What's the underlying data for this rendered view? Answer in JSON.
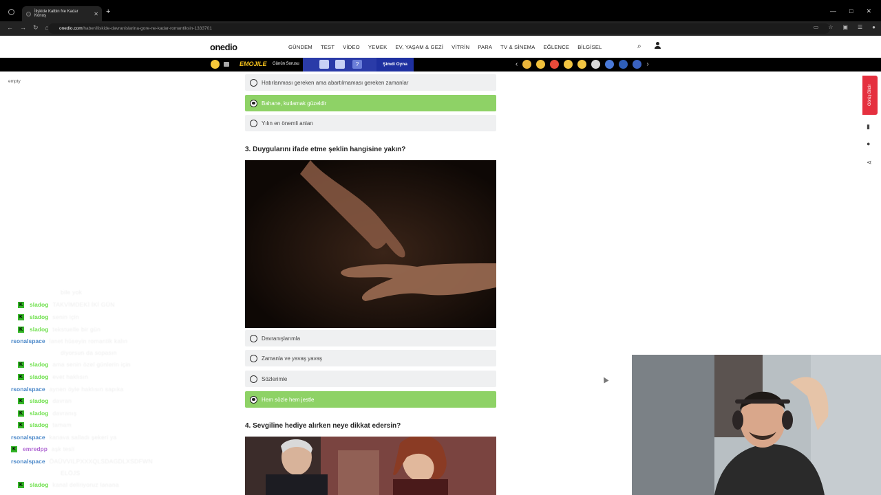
{
  "browser": {
    "tab_title": "İlişkide Kalbin Ne Kadar Konuş",
    "tab_close": "✕",
    "new_tab": "+",
    "url_host": "onedio.com",
    "url_path": "/haber/iliskide-davranislarina-gore-ne-kadar-romantiksin-1333701"
  },
  "site": {
    "logo": "onedio",
    "menu": [
      "GÜNDEM",
      "TEST",
      "VİDEO",
      "YEMEK",
      "EV, YAŞAM & GEZİ",
      "VİTRİN",
      "PARA",
      "TV & SİNEMA",
      "EĞLENCE",
      "BİLGİSEL"
    ]
  },
  "emoji_bar": {
    "brand": "EMOJILE",
    "daily": "Günün Sorusu",
    "question_mark": "?",
    "play": "Şimdi Oyna",
    "emoji_colors": [
      "#e9b43a",
      "#f0c03b",
      "#e84a3a",
      "#f2c542",
      "#f2c542",
      "#d9d9d9",
      "#4a7ad9",
      "#2f5fb8",
      "#3a62c0"
    ]
  },
  "sidebar": {
    "empty_label": "empty"
  },
  "quiz": {
    "q2_options": [
      {
        "label": "Hatırlanması gereken ama abartılmaması gereken zamanlar",
        "selected": false
      },
      {
        "label": "Bahane, kutlamak güzeldir",
        "selected": true
      },
      {
        "label": "Yılın en önemli anları",
        "selected": false
      }
    ],
    "q3_title": "3. Duygularını ifade etme şeklin hangisine yakın?",
    "q3_options": [
      {
        "label": "Davranışlarımla",
        "selected": false
      },
      {
        "label": "Zamanla ve yavaş yavaş",
        "selected": false
      },
      {
        "label": "Sözlerimle",
        "selected": false
      },
      {
        "label": "Hem sözle hem jestle",
        "selected": true
      }
    ],
    "q4_title": "4. Sevgiline hediye alırken neye dikkat edersin?"
  },
  "side_tools": {
    "red_tab": "Görüş Bildir"
  },
  "chat": [
    {
      "user": "",
      "msg": "bile yok",
      "badge": false,
      "color": "none"
    },
    {
      "user": "sladog",
      "msg": "TAKVİMDEKİ İKİ GÜN",
      "badge": true,
      "color": "sla"
    },
    {
      "user": "sladog",
      "msg": "senin için",
      "badge": true,
      "color": "sla"
    },
    {
      "user": "sladog",
      "msg": "tekstuelle bir gün",
      "badge": true,
      "color": "sla"
    },
    {
      "user": "rsonalspace",
      "msg": "lanet hüseyin romantik kalın",
      "badge": false,
      "color": "per"
    },
    {
      "user": "",
      "msg": "diyorsun da sopasın",
      "badge": false,
      "color": "none"
    },
    {
      "user": "sladog",
      "msg": "ama senin özel günlerin için",
      "badge": true,
      "color": "sla"
    },
    {
      "user": "sladog",
      "msg": "evet haklısın",
      "badge": true,
      "color": "sla"
    },
    {
      "user": "rsonalspace",
      "msg": "aynen öyle haklısın sapıka",
      "badge": false,
      "color": "per"
    },
    {
      "user": "sladog",
      "msg": "davran",
      "badge": true,
      "color": "sla"
    },
    {
      "user": "sladog",
      "msg": "davranış",
      "badge": true,
      "color": "sla"
    },
    {
      "user": "sladog",
      "msg": "tamam",
      "badge": true,
      "color": "sla"
    },
    {
      "user": "rsonalspace",
      "msg": "kanava salladı şekeri ya",
      "badge": false,
      "color": "per"
    },
    {
      "user": "emredpp",
      "msg": "aşk tesli",
      "badge": true,
      "color": "emr"
    },
    {
      "user": "rsonalspace",
      "msg": "ÖAÜVVILPXXXQLSDAGDLXSDFWN",
      "badge": false,
      "color": "per"
    },
    {
      "user": "",
      "msg": "ELÖJS",
      "badge": false,
      "color": "none"
    },
    {
      "user": "sladog",
      "msg": "kanal deliriyoruz lanana",
      "badge": true,
      "color": "sla"
    }
  ]
}
